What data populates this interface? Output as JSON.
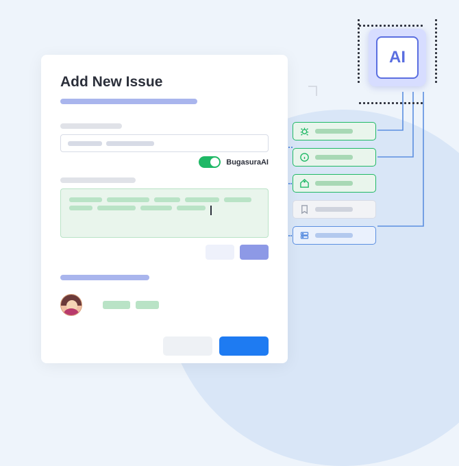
{
  "page": {
    "title": "Add New Issue",
    "toggle_label": "BugasuraAI"
  },
  "ai_chip": {
    "label": "AI"
  },
  "suggestions": [
    {
      "icon": "bug-icon",
      "style": "g"
    },
    {
      "icon": "info-icon",
      "style": "g"
    },
    {
      "icon": "tag-icon",
      "style": "g"
    },
    {
      "icon": "bookmark-icon",
      "style": "gr"
    },
    {
      "icon": "server-icon",
      "style": "b"
    }
  ],
  "colors": {
    "accent_blue": "#1e7bf2",
    "accent_green": "#1fb866",
    "accent_purple": "#8d99e6"
  }
}
